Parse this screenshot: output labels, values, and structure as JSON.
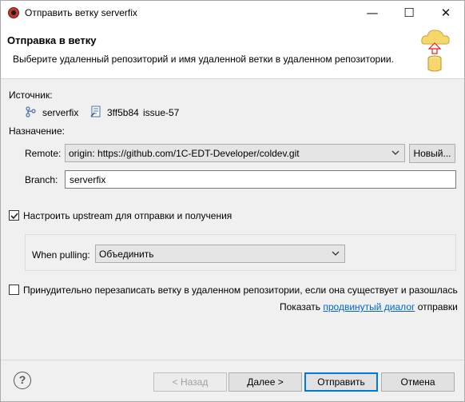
{
  "window": {
    "title": "Отправить ветку serverfix",
    "controls": {
      "minimize": "—",
      "maximize": "☐",
      "close": "✕"
    }
  },
  "header": {
    "title": "Отправка в ветку",
    "description": "Выберите удаленный репозиторий и имя удаленной ветки в удаленном репозитории."
  },
  "source": {
    "label": "Источник:",
    "branch": "serverfix",
    "commit_hash": "3ff5b84",
    "commit_message": "issue-57"
  },
  "destination": {
    "label": "Назначение:",
    "remote_label": "Remote:",
    "remote_value": "origin: https://github.com/1C-EDT-Developer/coldev.git",
    "new_button": "Новый...",
    "branch_label": "Branch:",
    "branch_value": "serverfix"
  },
  "upstream": {
    "checked": true,
    "label": "Настроить upstream для отправки и получения",
    "when_pulling_label": "When pulling:",
    "when_pulling_value": "Объединить"
  },
  "force": {
    "checked": false,
    "label": "Принудительно перезаписать ветку в удаленном репозитории, если она существует и разошлась"
  },
  "advanced": {
    "prefix": "Показать",
    "link": "продвинутый диалог",
    "suffix": "отправки"
  },
  "footer": {
    "help": "?",
    "back": "< Назад",
    "next": "Далее >",
    "push": "Отправить",
    "cancel": "Отмена"
  }
}
